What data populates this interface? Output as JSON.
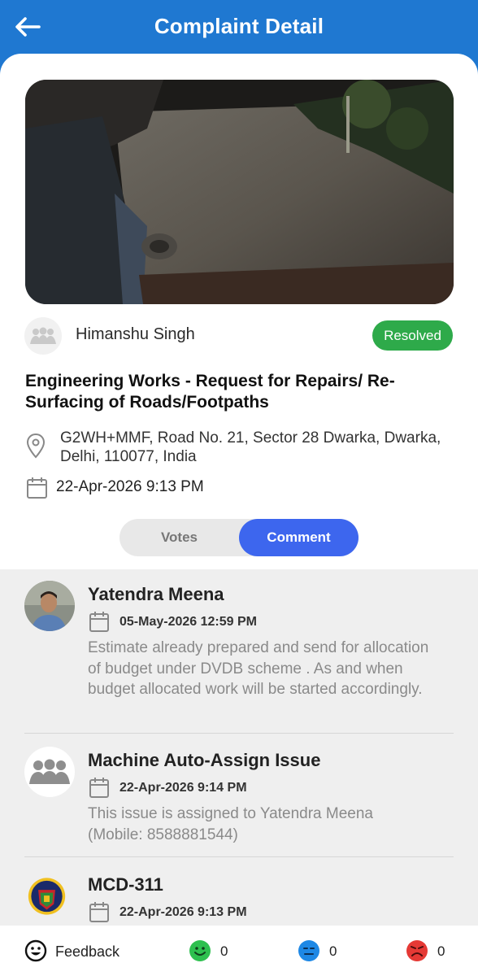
{
  "header": {
    "title": "Complaint Detail"
  },
  "complaint": {
    "reporter": "Himanshu Singh",
    "status": "Resolved",
    "category": "Engineering Works - Request for Repairs/ Re-Surfacing of Roads/Footpaths",
    "address": "G2WH+MMF, Road No. 21, Sector 28 Dwarka, Dwarka, Delhi, 110077, India",
    "date": "22-Apr-2026 9:13 PM"
  },
  "tabs": {
    "votes": "Votes",
    "comment": "Comment",
    "active": "comment"
  },
  "comments": [
    {
      "author": "Yatendra Meena",
      "date": "05-May-2026 12:59 PM",
      "text": "Estimate already prepared and send for allocation of budget under DVDB scheme . As and when budget allocated work will be started accordingly."
    },
    {
      "author": "Machine Auto-Assign Issue",
      "date": "22-Apr-2026 9:14 PM",
      "text": "This issue is assigned to Yatendra Meena (Mobile: 8588881544)"
    },
    {
      "author": "MCD-311",
      "date": "22-Apr-2026 9:13 PM",
      "text": ""
    }
  ],
  "footer": {
    "feedback_label": "Feedback",
    "happy_count": "0",
    "neutral_count": "0",
    "sad_count": "0"
  },
  "colors": {
    "primary": "#1f78d1",
    "resolved": "#2eaa4a",
    "active_tab": "#3d66ee",
    "happy": "#2ec04f",
    "neutral": "#1e88e5",
    "sad": "#e53935"
  }
}
